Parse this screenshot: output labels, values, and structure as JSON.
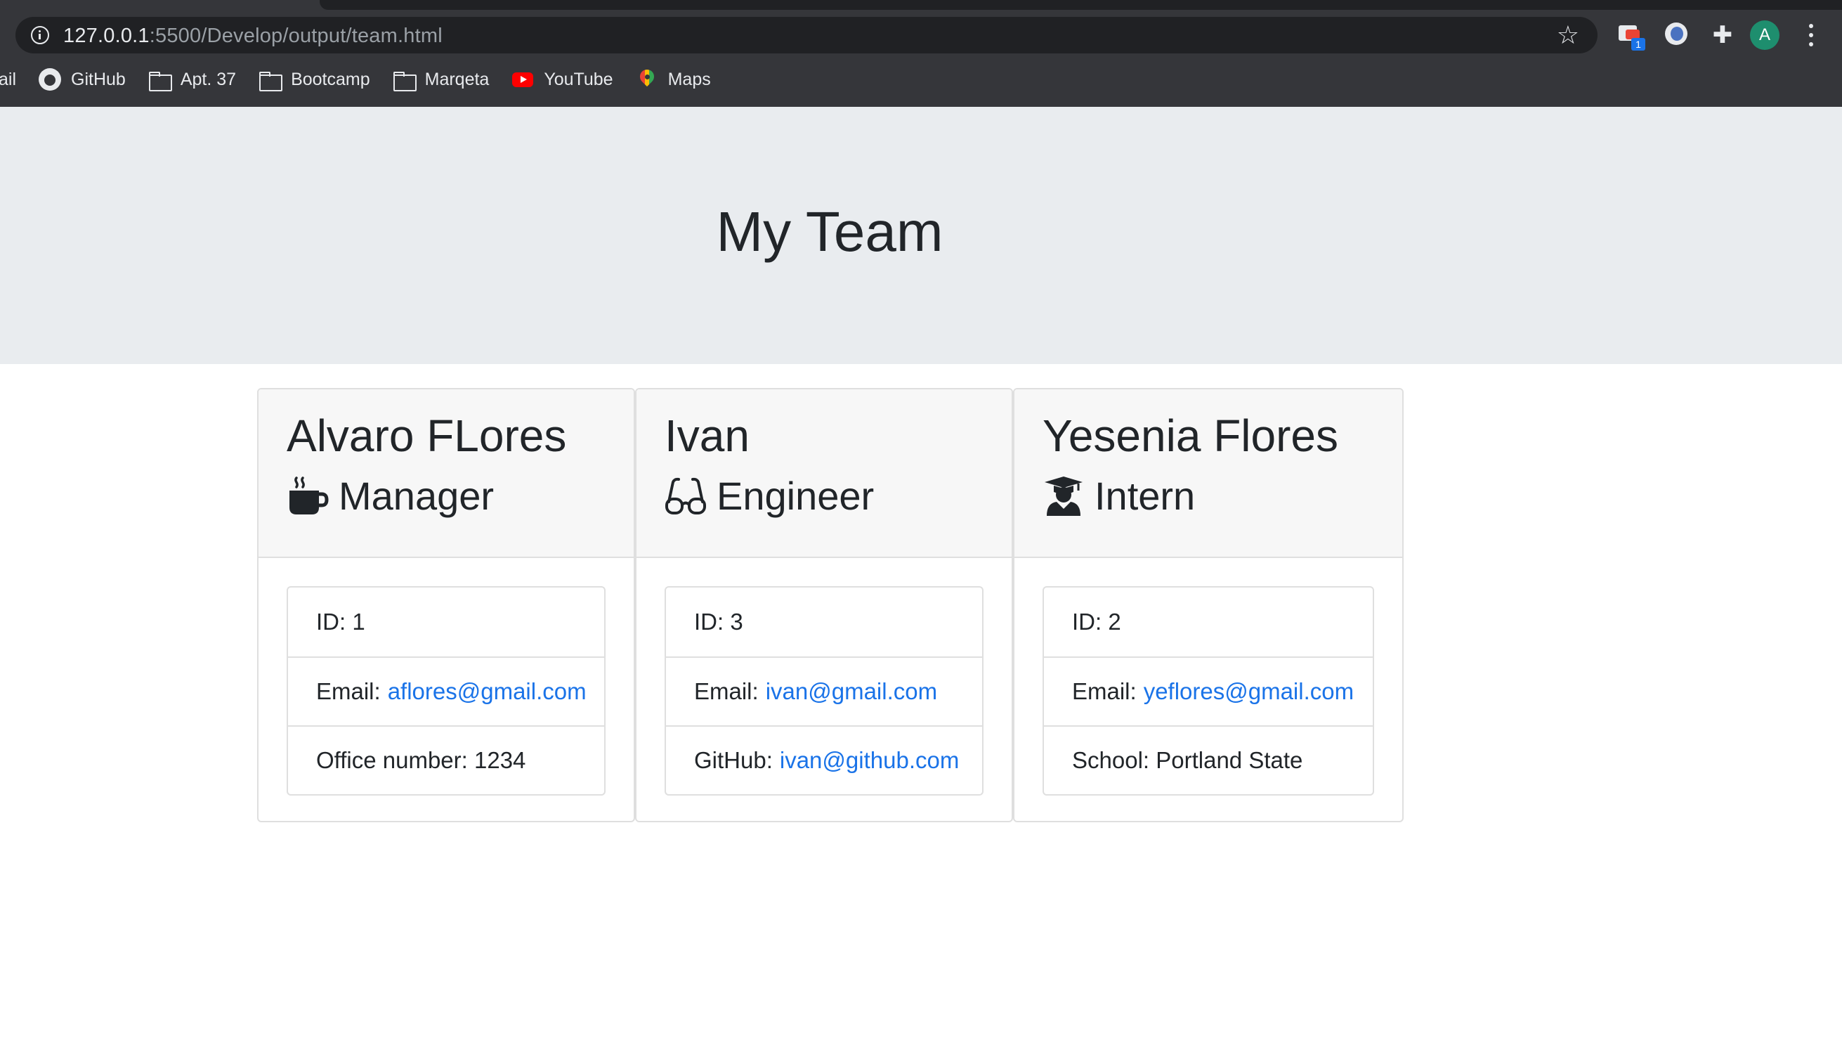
{
  "browser": {
    "url_host": "127.0.0.1",
    "url_path": ":5500/Develop/output/team.html",
    "translate_badge": "1",
    "profile_initial": "A",
    "bookmarks": {
      "cut_label": "ail",
      "items": [
        {
          "label": "GitHub",
          "icon": "github-icon"
        },
        {
          "label": "Apt. 37",
          "icon": "folder-icon"
        },
        {
          "label": "Bootcamp",
          "icon": "folder-icon"
        },
        {
          "label": "Marqeta",
          "icon": "folder-icon"
        },
        {
          "label": "YouTube",
          "icon": "youtube-icon"
        },
        {
          "label": "Maps",
          "icon": "maps-icon"
        }
      ]
    }
  },
  "page": {
    "title": "My Team"
  },
  "team": [
    {
      "name": "Alvaro FLores",
      "role": "Manager",
      "role_icon": "coffee-mug-icon",
      "id_text": "ID: 1",
      "email_label": "Email:",
      "email": "aflores@gmail.com",
      "extra_text": "Office number: 1234"
    },
    {
      "name": "Ivan",
      "role": "Engineer",
      "role_icon": "glasses-icon",
      "id_text": "ID: 3",
      "email_label": "Email:",
      "email": "ivan@gmail.com",
      "extra_label": "GitHub:",
      "extra_link": "ivan@github.com"
    },
    {
      "name": "Yesenia Flores",
      "role": "Intern",
      "role_icon": "graduate-icon",
      "id_text": "ID: 2",
      "email_label": "Email:",
      "email": "yeflores@gmail.com",
      "extra_text": "School: Portland State"
    }
  ],
  "colors": {
    "link": "#1a73e8",
    "jumbotron": "#e9ecef",
    "chrome_toolbar": "#35363a"
  }
}
